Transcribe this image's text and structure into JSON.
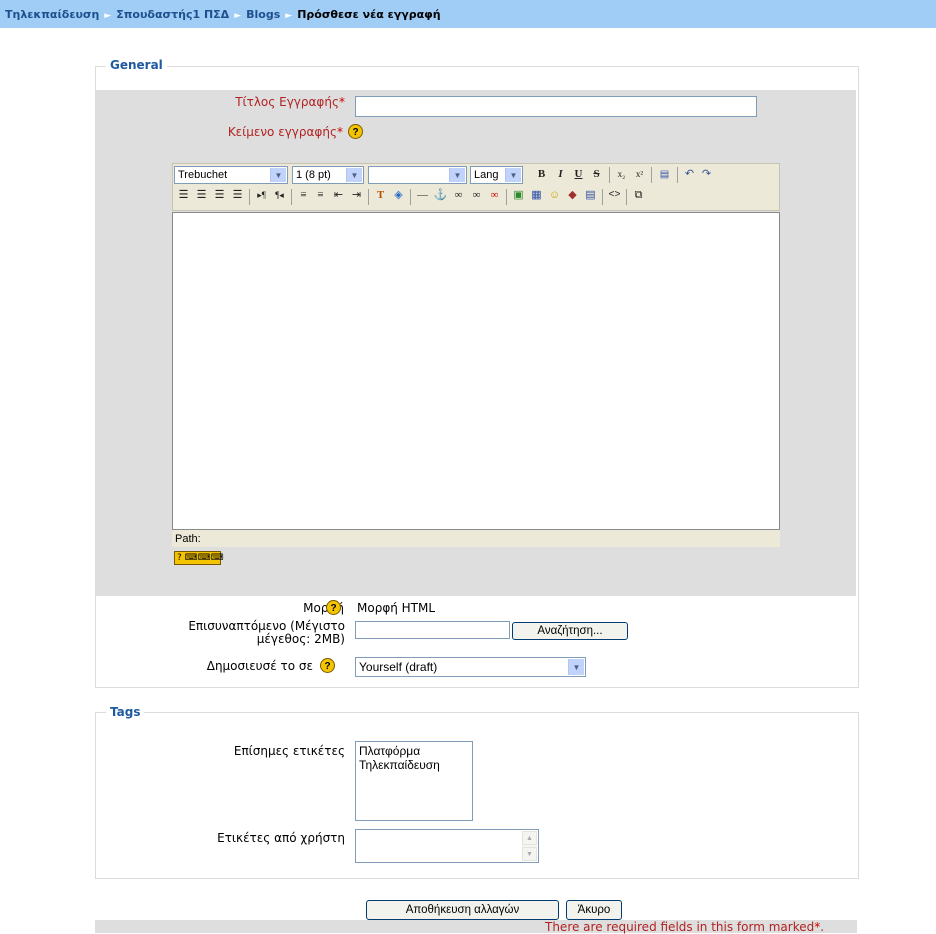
{
  "breadcrumb": {
    "items": [
      "Τηλεκπαίδευση",
      "Σπουδαστής1 ΠΣΔ",
      "Blogs"
    ],
    "current": "Πρόσθεσε νέα εγγραφή",
    "separator": "►"
  },
  "general": {
    "legend": "General",
    "title_label": "Τίτλος Εγγραφής",
    "title_value": "",
    "body_label": "Κείμενο εγγραφής",
    "required_marker": "*",
    "help_glyph": "?"
  },
  "editor": {
    "font_select": "Trebuchet",
    "size_select": "1 (8 pt)",
    "style_select": "",
    "lang_select": "Lang",
    "path_label": "Path:"
  },
  "format": {
    "label": "Μορφή",
    "value": "Μορφή HTML"
  },
  "attachment": {
    "label_line1": "Επισυναπτόμενο (Μέγιστο",
    "label_line2": "μέγεθος: 2MB)",
    "value": "",
    "browse_label": "Αναζήτηση..."
  },
  "publish": {
    "label": "Δημοσιευσέ το σε",
    "selected": "Yourself (draft)"
  },
  "tags": {
    "legend": "Tags",
    "official_label": "Επίσημες ετικέτες",
    "official_options": [
      "Πλατφόρμα",
      "Τηλεκπαίδευση"
    ],
    "user_label": "Ετικέτες από χρήστη",
    "user_value": ""
  },
  "buttons": {
    "save": "Αποθήκευση αλλαγών",
    "cancel": "Άκυρο"
  },
  "footer": {
    "required_note": "There are required fields in this form marked",
    "required_marker": "*",
    "period": "."
  },
  "colors": {
    "breadcrumb_bg": "#9fcdf5",
    "legend": "#1f5aa0",
    "required": "#b22222",
    "form_bg": "#dedede"
  }
}
